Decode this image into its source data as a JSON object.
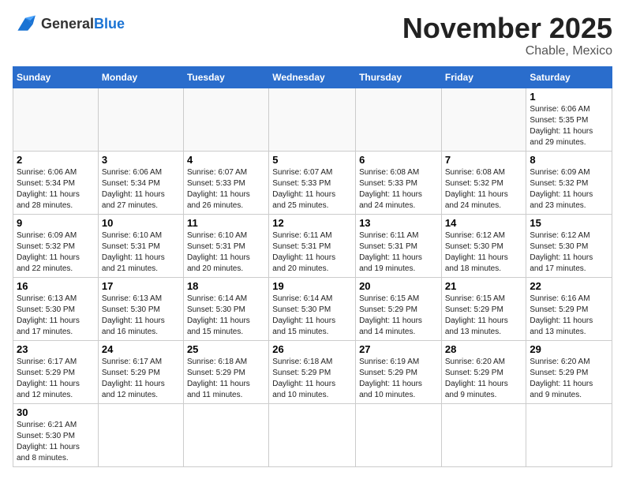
{
  "logo": {
    "general": "General",
    "blue": "Blue"
  },
  "title": "November 2025",
  "location": "Chable, Mexico",
  "days_header": [
    "Sunday",
    "Monday",
    "Tuesday",
    "Wednesday",
    "Thursday",
    "Friday",
    "Saturday"
  ],
  "weeks": [
    [
      {
        "day": "",
        "info": ""
      },
      {
        "day": "",
        "info": ""
      },
      {
        "day": "",
        "info": ""
      },
      {
        "day": "",
        "info": ""
      },
      {
        "day": "",
        "info": ""
      },
      {
        "day": "",
        "info": ""
      },
      {
        "day": "1",
        "info": "Sunrise: 6:06 AM\nSunset: 5:35 PM\nDaylight: 11 hours\nand 29 minutes."
      }
    ],
    [
      {
        "day": "2",
        "info": "Sunrise: 6:06 AM\nSunset: 5:34 PM\nDaylight: 11 hours\nand 28 minutes."
      },
      {
        "day": "3",
        "info": "Sunrise: 6:06 AM\nSunset: 5:34 PM\nDaylight: 11 hours\nand 27 minutes."
      },
      {
        "day": "4",
        "info": "Sunrise: 6:07 AM\nSunset: 5:33 PM\nDaylight: 11 hours\nand 26 minutes."
      },
      {
        "day": "5",
        "info": "Sunrise: 6:07 AM\nSunset: 5:33 PM\nDaylight: 11 hours\nand 25 minutes."
      },
      {
        "day": "6",
        "info": "Sunrise: 6:08 AM\nSunset: 5:33 PM\nDaylight: 11 hours\nand 24 minutes."
      },
      {
        "day": "7",
        "info": "Sunrise: 6:08 AM\nSunset: 5:32 PM\nDaylight: 11 hours\nand 24 minutes."
      },
      {
        "day": "8",
        "info": "Sunrise: 6:09 AM\nSunset: 5:32 PM\nDaylight: 11 hours\nand 23 minutes."
      }
    ],
    [
      {
        "day": "9",
        "info": "Sunrise: 6:09 AM\nSunset: 5:32 PM\nDaylight: 11 hours\nand 22 minutes."
      },
      {
        "day": "10",
        "info": "Sunrise: 6:10 AM\nSunset: 5:31 PM\nDaylight: 11 hours\nand 21 minutes."
      },
      {
        "day": "11",
        "info": "Sunrise: 6:10 AM\nSunset: 5:31 PM\nDaylight: 11 hours\nand 20 minutes."
      },
      {
        "day": "12",
        "info": "Sunrise: 6:11 AM\nSunset: 5:31 PM\nDaylight: 11 hours\nand 20 minutes."
      },
      {
        "day": "13",
        "info": "Sunrise: 6:11 AM\nSunset: 5:31 PM\nDaylight: 11 hours\nand 19 minutes."
      },
      {
        "day": "14",
        "info": "Sunrise: 6:12 AM\nSunset: 5:30 PM\nDaylight: 11 hours\nand 18 minutes."
      },
      {
        "day": "15",
        "info": "Sunrise: 6:12 AM\nSunset: 5:30 PM\nDaylight: 11 hours\nand 17 minutes."
      }
    ],
    [
      {
        "day": "16",
        "info": "Sunrise: 6:13 AM\nSunset: 5:30 PM\nDaylight: 11 hours\nand 17 minutes."
      },
      {
        "day": "17",
        "info": "Sunrise: 6:13 AM\nSunset: 5:30 PM\nDaylight: 11 hours\nand 16 minutes."
      },
      {
        "day": "18",
        "info": "Sunrise: 6:14 AM\nSunset: 5:30 PM\nDaylight: 11 hours\nand 15 minutes."
      },
      {
        "day": "19",
        "info": "Sunrise: 6:14 AM\nSunset: 5:30 PM\nDaylight: 11 hours\nand 15 minutes."
      },
      {
        "day": "20",
        "info": "Sunrise: 6:15 AM\nSunset: 5:29 PM\nDaylight: 11 hours\nand 14 minutes."
      },
      {
        "day": "21",
        "info": "Sunrise: 6:15 AM\nSunset: 5:29 PM\nDaylight: 11 hours\nand 13 minutes."
      },
      {
        "day": "22",
        "info": "Sunrise: 6:16 AM\nSunset: 5:29 PM\nDaylight: 11 hours\nand 13 minutes."
      }
    ],
    [
      {
        "day": "23",
        "info": "Sunrise: 6:17 AM\nSunset: 5:29 PM\nDaylight: 11 hours\nand 12 minutes."
      },
      {
        "day": "24",
        "info": "Sunrise: 6:17 AM\nSunset: 5:29 PM\nDaylight: 11 hours\nand 12 minutes."
      },
      {
        "day": "25",
        "info": "Sunrise: 6:18 AM\nSunset: 5:29 PM\nDaylight: 11 hours\nand 11 minutes."
      },
      {
        "day": "26",
        "info": "Sunrise: 6:18 AM\nSunset: 5:29 PM\nDaylight: 11 hours\nand 10 minutes."
      },
      {
        "day": "27",
        "info": "Sunrise: 6:19 AM\nSunset: 5:29 PM\nDaylight: 11 hours\nand 10 minutes."
      },
      {
        "day": "28",
        "info": "Sunrise: 6:20 AM\nSunset: 5:29 PM\nDaylight: 11 hours\nand 9 minutes."
      },
      {
        "day": "29",
        "info": "Sunrise: 6:20 AM\nSunset: 5:29 PM\nDaylight: 11 hours\nand 9 minutes."
      }
    ],
    [
      {
        "day": "30",
        "info": "Sunrise: 6:21 AM\nSunset: 5:30 PM\nDaylight: 11 hours\nand 8 minutes."
      },
      {
        "day": "",
        "info": ""
      },
      {
        "day": "",
        "info": ""
      },
      {
        "day": "",
        "info": ""
      },
      {
        "day": "",
        "info": ""
      },
      {
        "day": "",
        "info": ""
      },
      {
        "day": "",
        "info": ""
      }
    ]
  ]
}
